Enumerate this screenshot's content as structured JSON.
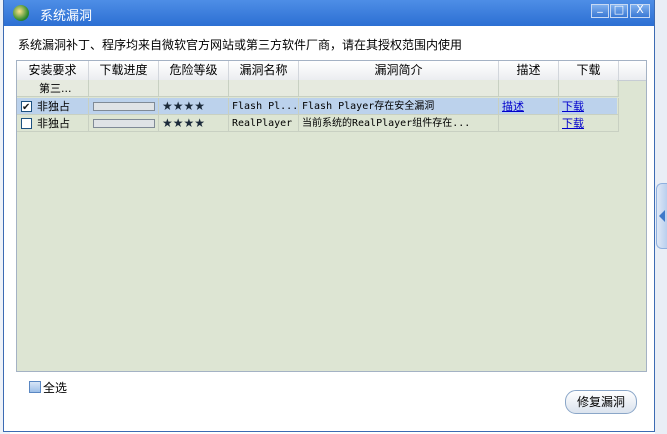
{
  "window": {
    "title": "系统漏洞",
    "minimize_glyph": "_",
    "maximize_glyph": "□",
    "close_glyph": "X"
  },
  "info_text": "系统漏洞补丁、程序均来自微软官方网站或第三方软件厂商，请在其授权范围内使用",
  "table": {
    "headers": [
      "安装要求",
      "下载进度",
      "危险等级",
      "漏洞名称",
      "漏洞简介",
      "描述",
      "下载"
    ],
    "group_label": "第三...",
    "rows": [
      {
        "checked": true,
        "install": "非独占",
        "progress": 0,
        "stars": "★★★★",
        "name": "Flash Pl...",
        "desc": "Flash Player存在安全漏洞",
        "describe_link": "描述",
        "download_link": "下载"
      },
      {
        "checked": false,
        "install": "非独占",
        "progress": 0,
        "stars": "★★★★",
        "name": "RealPlayer",
        "desc": "当前系统的RealPlayer组件存在...",
        "describe_link": "",
        "download_link": "下载"
      }
    ]
  },
  "select_all_label": "全选",
  "fix_button_label": "修复漏洞",
  "colors": {
    "titlebar": "#2c6fd3",
    "table_bg": "#dde5d3",
    "selected_row": "#bcd2ec",
    "link": "#0000cc"
  }
}
